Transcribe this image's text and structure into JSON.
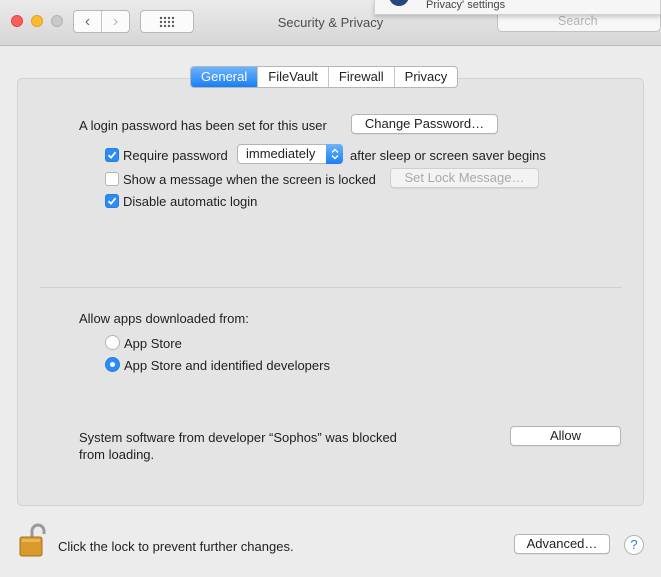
{
  "window": {
    "title": "Security & Privacy",
    "search_placeholder": "Search",
    "notification_text": "Privacy' settings"
  },
  "tabs": [
    {
      "label": "General",
      "active": true
    },
    {
      "label": "FileVault",
      "active": false
    },
    {
      "label": "Firewall",
      "active": false
    },
    {
      "label": "Privacy",
      "active": false
    }
  ],
  "general": {
    "login_password_text": "A login password has been set for this user",
    "change_password_button": "Change Password…",
    "require_password": {
      "label": "Require password",
      "checked": true
    },
    "require_password_delay": "immediately",
    "after_sleep_text": "after sleep or screen saver begins",
    "show_message": {
      "label": "Show a message when the screen is locked",
      "checked": false
    },
    "set_lock_message_button": "Set Lock Message…",
    "disable_auto_login": {
      "label": "Disable automatic login",
      "checked": true
    }
  },
  "allow_apps": {
    "heading": "Allow apps downloaded from:",
    "options": [
      {
        "label": "App Store",
        "selected": false
      },
      {
        "label": "App Store and identified developers",
        "selected": true
      }
    ]
  },
  "system_software": {
    "message_line1": "System software from developer “Sophos” was blocked",
    "message_line2": "from loading.",
    "allow_button": "Allow"
  },
  "footer": {
    "lock_text": "Click the lock to prevent further changes.",
    "advanced_button": "Advanced…",
    "help_symbol": "?"
  },
  "colors": {
    "accent": "#1a7ff5",
    "close": "#fc5f57",
    "minimize": "#fdbc2e",
    "lock_gold": "#d79a2c"
  }
}
